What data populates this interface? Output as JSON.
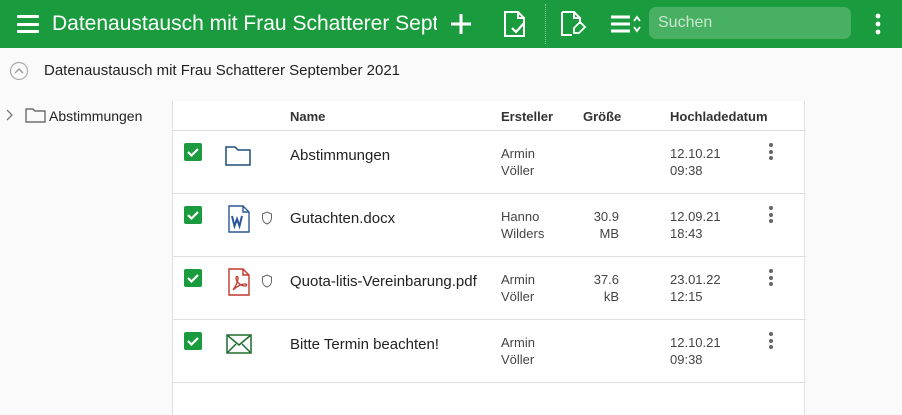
{
  "topbar": {
    "title": "Datenaustausch mit Frau Schatterer Sept...",
    "search_placeholder": "Suchen"
  },
  "breadcrumb": {
    "text": "Datenaustausch mit Frau Schatterer September 2021"
  },
  "tree": {
    "items": [
      {
        "label": "Abstimmungen"
      }
    ]
  },
  "table": {
    "headers": {
      "name": "Name",
      "creator": "Ersteller",
      "size": "Größe",
      "date": "Hochladedatum"
    },
    "rows": [
      {
        "icon": "folder-icon",
        "name": "Abstimmungen",
        "creator1": "Armin",
        "creator2": "Völler",
        "size1": "",
        "size2": "",
        "date1": "12.10.21",
        "date2": "09:38",
        "protected": false,
        "checked": true
      },
      {
        "icon": "word-document-icon",
        "name": "Gutachten.docx",
        "creator1": "Hanno",
        "creator2": "Wilders",
        "size1": "30.9",
        "size2": "MB",
        "date1": "12.09.21",
        "date2": "18:43",
        "protected": true,
        "checked": true
      },
      {
        "icon": "pdf-document-icon",
        "name": "Quota-litis-Vereinbarung.pdf",
        "creator1": "Armin",
        "creator2": "Völler",
        "size1": "37.6",
        "size2": "kB",
        "date1": "23.01.22",
        "date2": "12:15",
        "protected": true,
        "checked": true
      },
      {
        "icon": "email-icon",
        "name": "Bitte Termin beachten!",
        "creator1": "Armin",
        "creator2": "Völler",
        "size1": "",
        "size2": "",
        "date1": "12.10.21",
        "date2": "09:38",
        "protected": false,
        "checked": true
      }
    ]
  },
  "colors": {
    "accent": "#1a9c3e",
    "folder": "#1f4e79",
    "word": "#2b5797",
    "pdf": "#c0392b",
    "mail": "#1e6b2f"
  }
}
